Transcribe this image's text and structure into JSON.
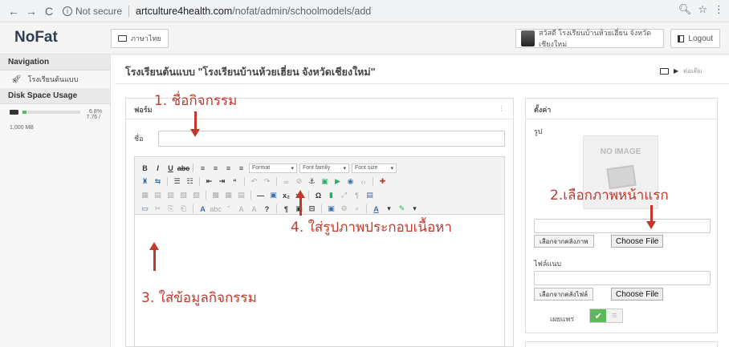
{
  "browser": {
    "back_icon": "←",
    "forward_icon": "→",
    "reload_icon": "C",
    "security": "Not secure",
    "url_host": "artculture4health.com",
    "url_path": "/nofat/admin/schoolmodels/add"
  },
  "header": {
    "brand": "NoFat",
    "language_label": "ภาษาไทย",
    "user_label": "สวัสดี โรงเรียนบ้านห้วยเฮี่ยน จังหวัดเชียงใหม่",
    "logout_label": "Logout"
  },
  "sidebar": {
    "nav_heading": "Navigation",
    "nav_items": [
      {
        "label": "โรงเรียนต้นแบบ",
        "icon": "rocket-icon"
      }
    ],
    "disk_heading": "Disk Space Usage",
    "disk_percent": "6.8%",
    "disk_fraction": 0.068,
    "disk_used": "7.76 /",
    "disk_total": "1,000 MB"
  },
  "main": {
    "page_title": "โรงเรียนต้นแบบ \"โรงเรียนบ้านห้วยเฮี่ยน จังหวัดเชียงใหม่\"",
    "breadcrumb": "ต่อเติม",
    "form_title": "ฟอร์ม",
    "form_menu": "⋮",
    "name_label": "ชื่อ",
    "toolbar": {
      "format": "Format",
      "font_family": "Font family",
      "font_size": "Font size"
    }
  },
  "side": {
    "title": "ตั้งค่า",
    "image_label": "รูป",
    "no_image": "NO IMAGE",
    "browse_image": "เลือกจากคลังภาพ",
    "choose_file": "Choose File",
    "attachment_label": "ไฟล์แนบ",
    "browse_file": "เลือกจากคลังไฟล์",
    "choose_file_2": "Choose File",
    "publish_label": "เผยแพร่"
  },
  "annotations": {
    "a1": "1. ชื่อกิจกรรม",
    "a2": "2.เลือกภาพหน้าแรก",
    "a3": "3. ใส่ข้อมูลกิจกรรม",
    "a4": "4. ใส่รูปภาพประกอบเนื้อหา"
  },
  "colors": {
    "annotation": "#c0392b",
    "toggle_on": "#5cb85c"
  }
}
